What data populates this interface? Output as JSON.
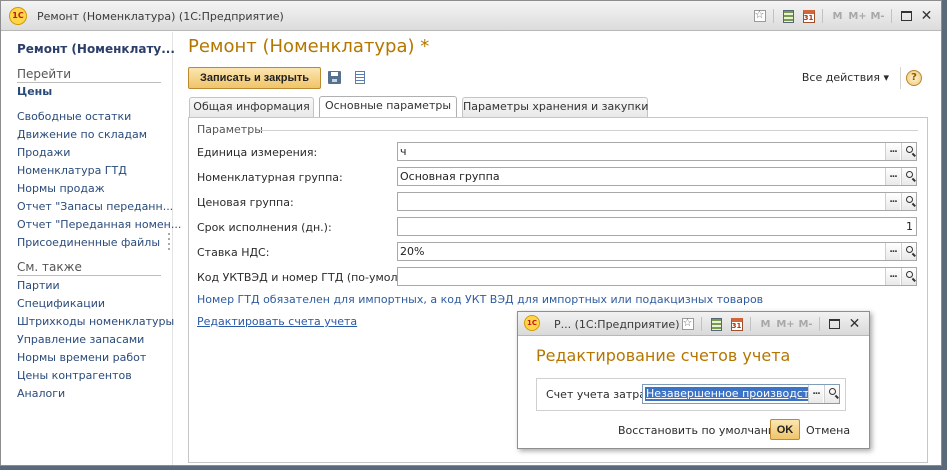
{
  "window": {
    "title": "Ремонт (Номенклатура)  (1С:Предприятие)",
    "logo": "1С"
  },
  "toolbar_icons": [
    "favorites-icon",
    "calculator-icon",
    "calendar-icon"
  ],
  "calendar_day": "31",
  "memory_buttons": [
    "M",
    "M+",
    "M-"
  ],
  "nav": {
    "title": "Ремонт (Номенклату...",
    "goto_header": "Перейти",
    "goto_bold": "Цены",
    "goto_items": [
      "Свободные остатки",
      "Движение по складам",
      "Продажи",
      "Номенклатура ГТД",
      "Нормы продаж",
      "Отчет \"Запасы переданн...",
      "Отчет \"Переданная номен...",
      "Присоединенные файлы"
    ],
    "see_also_header": "См. также",
    "see_also_items": [
      "Партии",
      "Спецификации",
      "Штрихкоды номенклатуры",
      "Управление запасами",
      "Нормы времени работ",
      "Цены контрагентов",
      "Аналоги"
    ]
  },
  "form": {
    "title": "Ремонт (Номенклатура) *",
    "save_close_label": "Записать и закрыть",
    "all_actions_label": "Все действия ▾",
    "help_label": "?",
    "tabs": [
      "Общая информация",
      "Основные параметры",
      "Параметры хранения и закупки"
    ],
    "group_title": "Параметры",
    "fields": [
      {
        "label": "Единица измерения:",
        "value": "ч"
      },
      {
        "label": "Номенклатурная группа:",
        "value": "Основная группа"
      },
      {
        "label": "Ценовая группа:",
        "value": ""
      },
      {
        "label": "Срок исполнения (дн.):",
        "value": "1"
      },
      {
        "label": "Ставка НДС:",
        "value": "20%"
      },
      {
        "label": "Код УКТВЭД и номер ГТД (по-умолч.):",
        "value": ""
      }
    ],
    "note": "Номер ГТД обязателен для импортных, а код УКТ ВЭД для импортных или подакцизных товаров",
    "edit_accounts_link": "Редактировать счета учета",
    "choose_button": "...",
    "search_button": "search-icon"
  },
  "dialog": {
    "title": "Р...  (1С:Предприятие)",
    "heading": "Редактирование счетов учета",
    "field_label": "Счет учета затрат:",
    "field_value": "Незавершенное производство",
    "restore_label": "Восстановить по умолчанию",
    "ok_label": "OK",
    "cancel_label": "Отмена"
  },
  "colors": {
    "title_accent": "#b57600",
    "link": "#2a59a8",
    "selection": "#3d73c4",
    "button_fill": "#f0c46a"
  }
}
